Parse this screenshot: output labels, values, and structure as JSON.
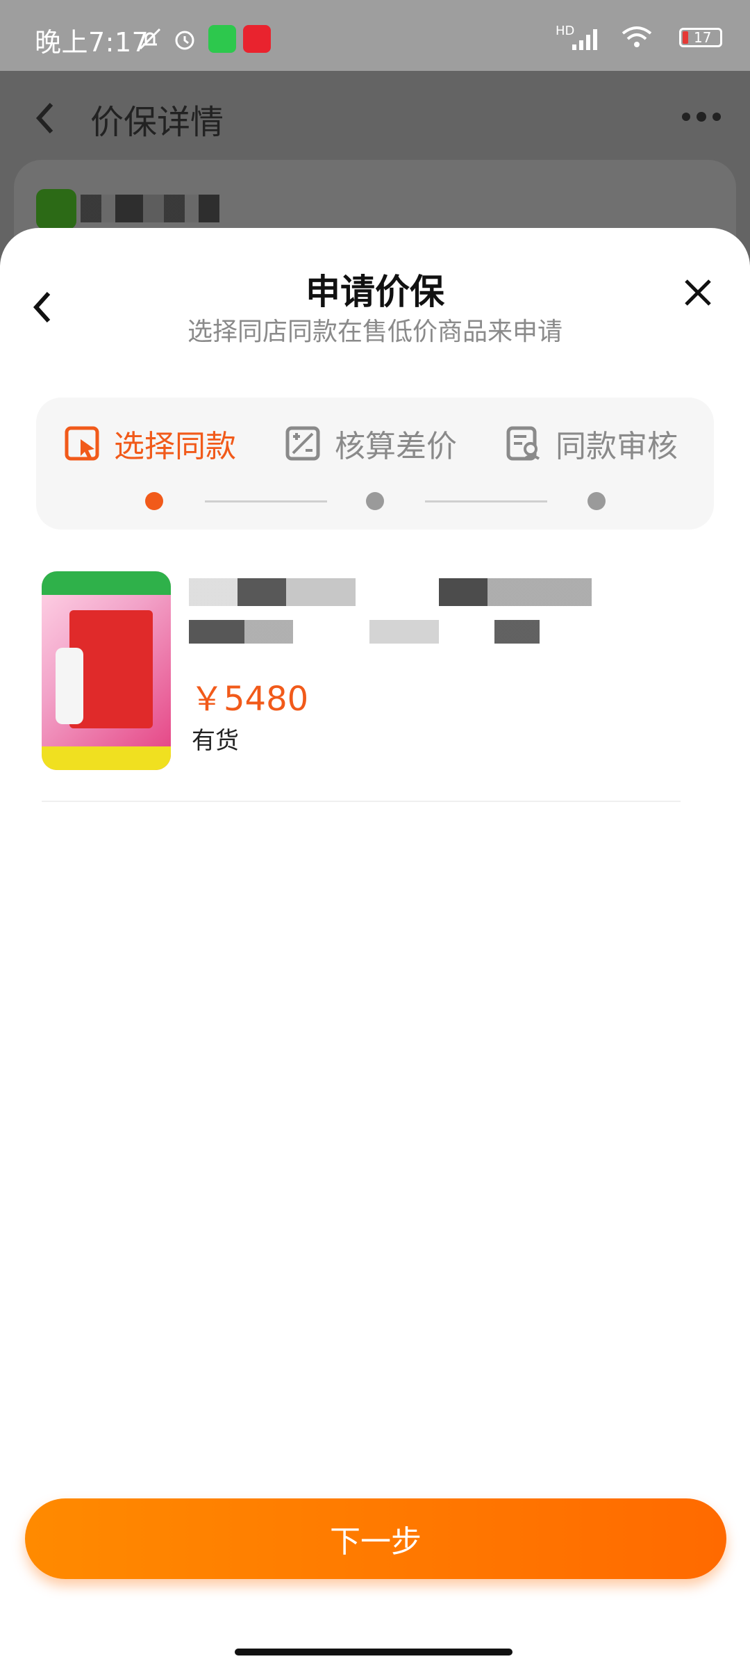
{
  "status_bar": {
    "time": "晚上7:17",
    "battery": "17",
    "network": "HD"
  },
  "background_page": {
    "title": "价保详情"
  },
  "sheet": {
    "title": "申请价保",
    "subtitle": "选择同店同款在售低价商品来申请",
    "steps": [
      {
        "label": "选择同款",
        "state": "active"
      },
      {
        "label": "核算差价",
        "state": "inactive"
      },
      {
        "label": "同款审核",
        "state": "inactive"
      }
    ],
    "product": {
      "price": "￥5480",
      "stock": "有货"
    },
    "next_button": "下一步"
  },
  "colors": {
    "accent": "#f15a1a",
    "button_start": "#ff8a00",
    "button_end": "#ff6a00"
  }
}
